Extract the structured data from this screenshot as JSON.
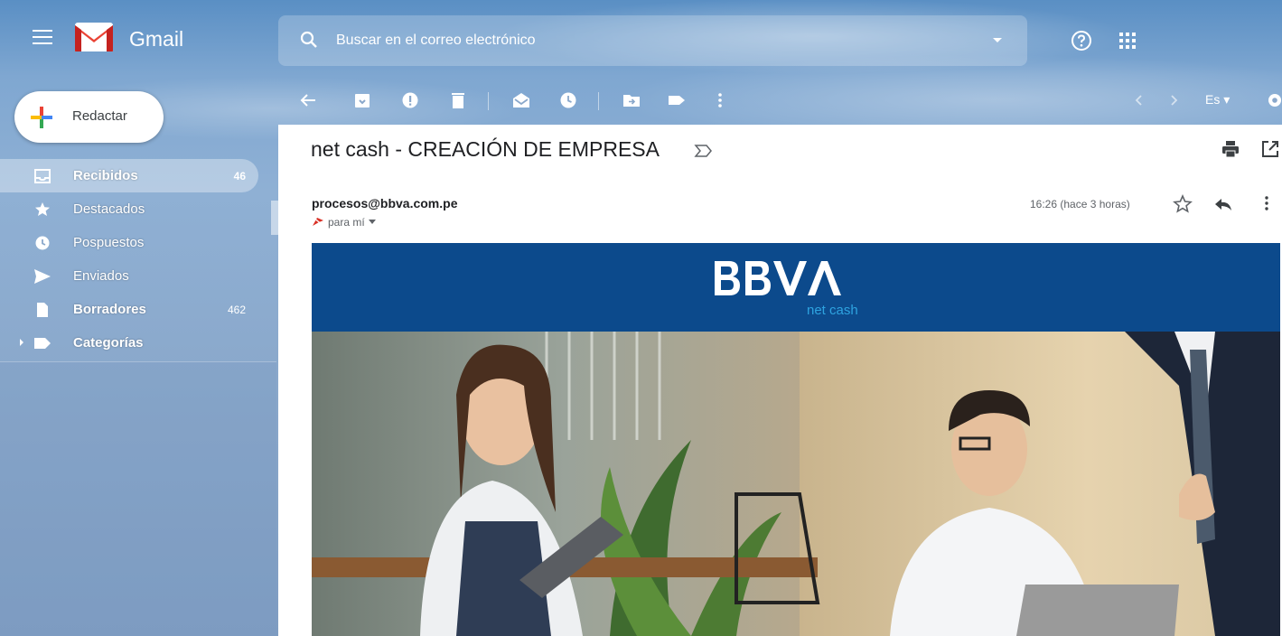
{
  "header": {
    "app_name": "Gmail",
    "search_placeholder": "Buscar en el correo electrónico"
  },
  "compose": {
    "label": "Redactar"
  },
  "nav": {
    "items": [
      {
        "label": "Recibidos",
        "count": "46",
        "active": true,
        "bold": true,
        "icon": "inbox-icon"
      },
      {
        "label": "Destacados",
        "count": "",
        "active": false,
        "bold": false,
        "icon": "star-icon"
      },
      {
        "label": "Pospuestos",
        "count": "",
        "active": false,
        "bold": false,
        "icon": "clock-icon"
      },
      {
        "label": "Enviados",
        "count": "",
        "active": false,
        "bold": false,
        "icon": "send-icon"
      },
      {
        "label": "Borradores",
        "count": "462",
        "active": false,
        "bold": true,
        "icon": "draft-icon"
      },
      {
        "label": "Categorías",
        "count": "",
        "active": false,
        "bold": true,
        "icon": "label-icon"
      }
    ]
  },
  "toolbar": {
    "language": "Es"
  },
  "email": {
    "subject": "net cash - CREACIÓN DE EMPRESA",
    "sender": "procesos@bbva.com.pe",
    "recipient": "para mí",
    "timestamp": "16:26 (hace 3 horas)",
    "banner": {
      "brand": "BBVA",
      "product": "net cash"
    }
  },
  "colors": {
    "banner_bg": "#0c4a8c",
    "netcash_accent": "#2ea3e0",
    "gmail_red": "#ea4335"
  }
}
